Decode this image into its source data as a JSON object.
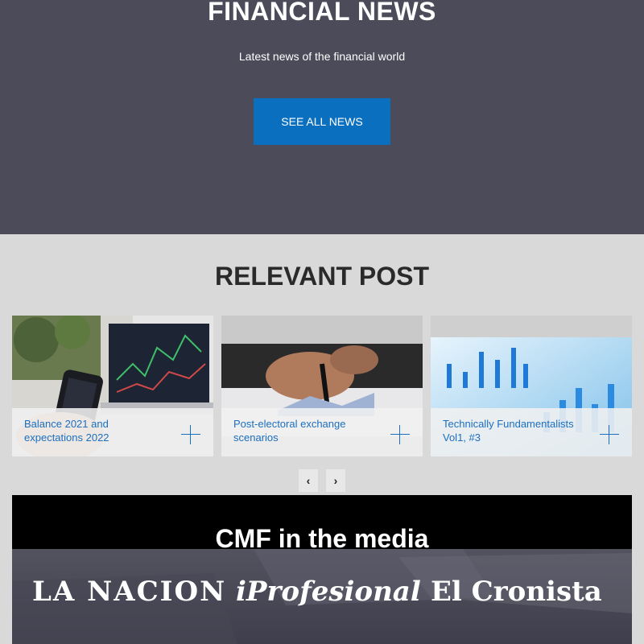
{
  "hero": {
    "title": "FINANCIAL NEWS",
    "subtitle": "Latest news of the financial world",
    "button_label": "SEE ALL NEWS"
  },
  "relevant": {
    "title": "RELEVANT POST",
    "cards": [
      {
        "label": "Balance 2021 and expectations 2022",
        "icon": "plus-icon"
      },
      {
        "label": "Post-electoral exchange scenarios",
        "icon": "plus-icon"
      },
      {
        "label": "Technically Fundamentalists Vol1, #3",
        "icon": "plus-icon"
      }
    ],
    "prev_icon": "‹",
    "next_icon": "›"
  },
  "media": {
    "title": "CMF in the media",
    "logos": [
      "LA NACION",
      "iProfesional",
      "El Cronista"
    ]
  },
  "colors": {
    "hero_bg": "#4b4b5a",
    "accent": "#0b6fc0",
    "link": "#1b6fc0",
    "section_bg": "#d9d9d9"
  }
}
